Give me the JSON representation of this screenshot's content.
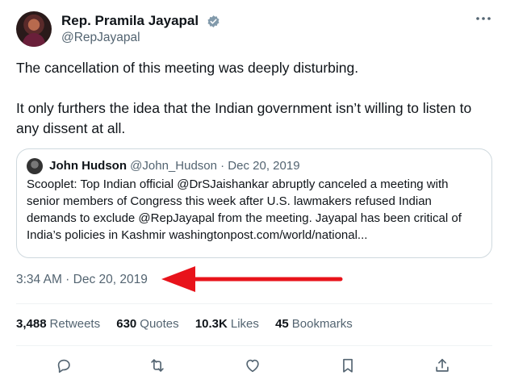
{
  "author": {
    "name": "Rep. Pramila Jayapal",
    "handle": "@RepJayapal"
  },
  "tweet": {
    "paragraphs": [
      "The cancellation of this meeting was deeply disturbing.",
      "It only furthers the idea that the Indian government isn’t willing to listen to any dissent at all."
    ],
    "timestamp": "3:34 AM · Dec 20, 2019"
  },
  "quoted_tweet": {
    "name": "John Hudson",
    "handle": "@John_Hudson · Dec 20, 2019",
    "text": "Scooplet: Top Indian official @DrSJaishankar abruptly canceled a meeting with senior members of Congress this week after U.S. lawmakers refused Indian demands to exclude @RepJayapal from the meeting. Jayapal has been critical of India’s policies in Kashmir washingtonpost.com/world/national..."
  },
  "stats": {
    "retweets_count": "3,488",
    "retweets_label": "Retweets",
    "quotes_count": "630",
    "quotes_label": "Quotes",
    "likes_count": "10.3K",
    "likes_label": "Likes",
    "bookmarks_count": "45",
    "bookmarks_label": "Bookmarks"
  },
  "colors": {
    "verified": "#1d9bf0",
    "arrow": "#e8131b",
    "secondary_text": "#536471"
  },
  "icons": [
    "verified-badge-icon",
    "more-icon",
    "reply-icon",
    "retweet-icon",
    "like-icon",
    "bookmark-icon",
    "share-icon",
    "red-arrow-annotation"
  ]
}
